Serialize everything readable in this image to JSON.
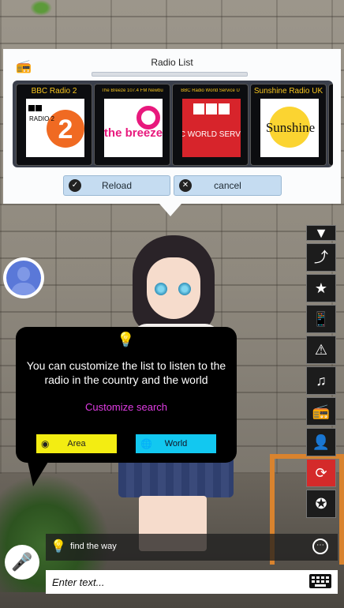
{
  "radio_panel": {
    "title": "Radio List",
    "stations": [
      {
        "name": "BBC Radio 2",
        "logo_text": "RADIO 2"
      },
      {
        "name": "The Breeze 107.4 FM Newbu",
        "logo_text": "the breeze"
      },
      {
        "name": "BBC Radio World Service U",
        "logo_text": "BBC WORLD SERVICE"
      },
      {
        "name": "Sunshine Radio UK",
        "logo_text": "Sunshine"
      }
    ],
    "reload_label": "Reload",
    "cancel_label": "cancel"
  },
  "bubble": {
    "message": "You can customize the list to listen to the radio in the country and the world",
    "link": "Customize search",
    "area_label": "Area",
    "world_label": "World"
  },
  "hint": {
    "text": "find the way"
  },
  "input": {
    "placeholder": "Enter text..."
  },
  "colors": {
    "station_name": "#f7c51e",
    "link": "#e03ce3",
    "area_button": "#f3ed12",
    "world_button": "#12c8f0",
    "panel_button": "#c5dcf1"
  },
  "side_icons": [
    "share-icon",
    "star-icon",
    "phone-book-icon",
    "warning-icon",
    "music-icon",
    "radio-icon",
    "contacts-icon",
    "record-icon",
    "carrot-icon"
  ]
}
